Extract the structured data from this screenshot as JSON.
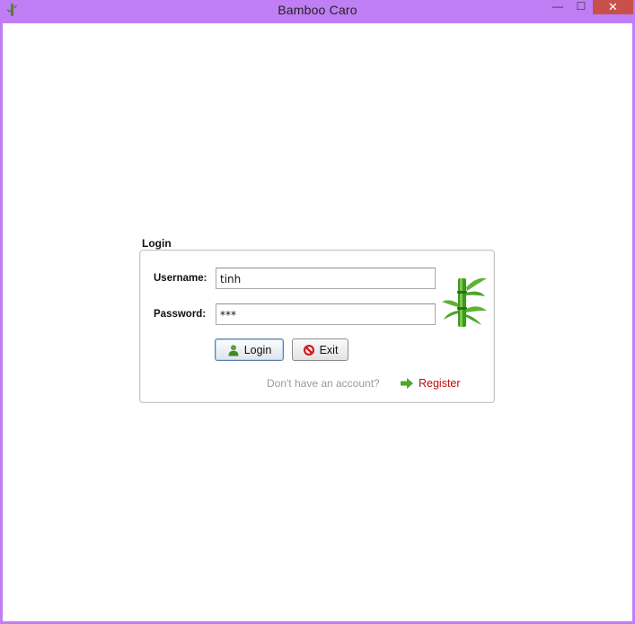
{
  "window": {
    "title": "Bamboo Caro",
    "app_icon": "bamboo-icon",
    "controls": {
      "minimize": "—",
      "maximize": "☐",
      "close": "✕"
    }
  },
  "login": {
    "section_title": "Login",
    "username_label": "Username:",
    "username_value": "tinh",
    "password_label": "Password:",
    "password_value": "***",
    "login_button": "Login",
    "login_icon": "user-icon",
    "exit_button": "Exit",
    "exit_icon": "no-entry-icon",
    "account_hint": "Don't have an account?",
    "register_link": "Register",
    "register_icon": "arrow-right-icon",
    "logo_icon": "bamboo-icon"
  },
  "colors": {
    "titlebar": "#c07ef4",
    "close_button": "#c7504b",
    "register_link": "#c40b0b",
    "hint_text": "#9a9a9a",
    "bamboo_green": "#3a9a1f"
  }
}
